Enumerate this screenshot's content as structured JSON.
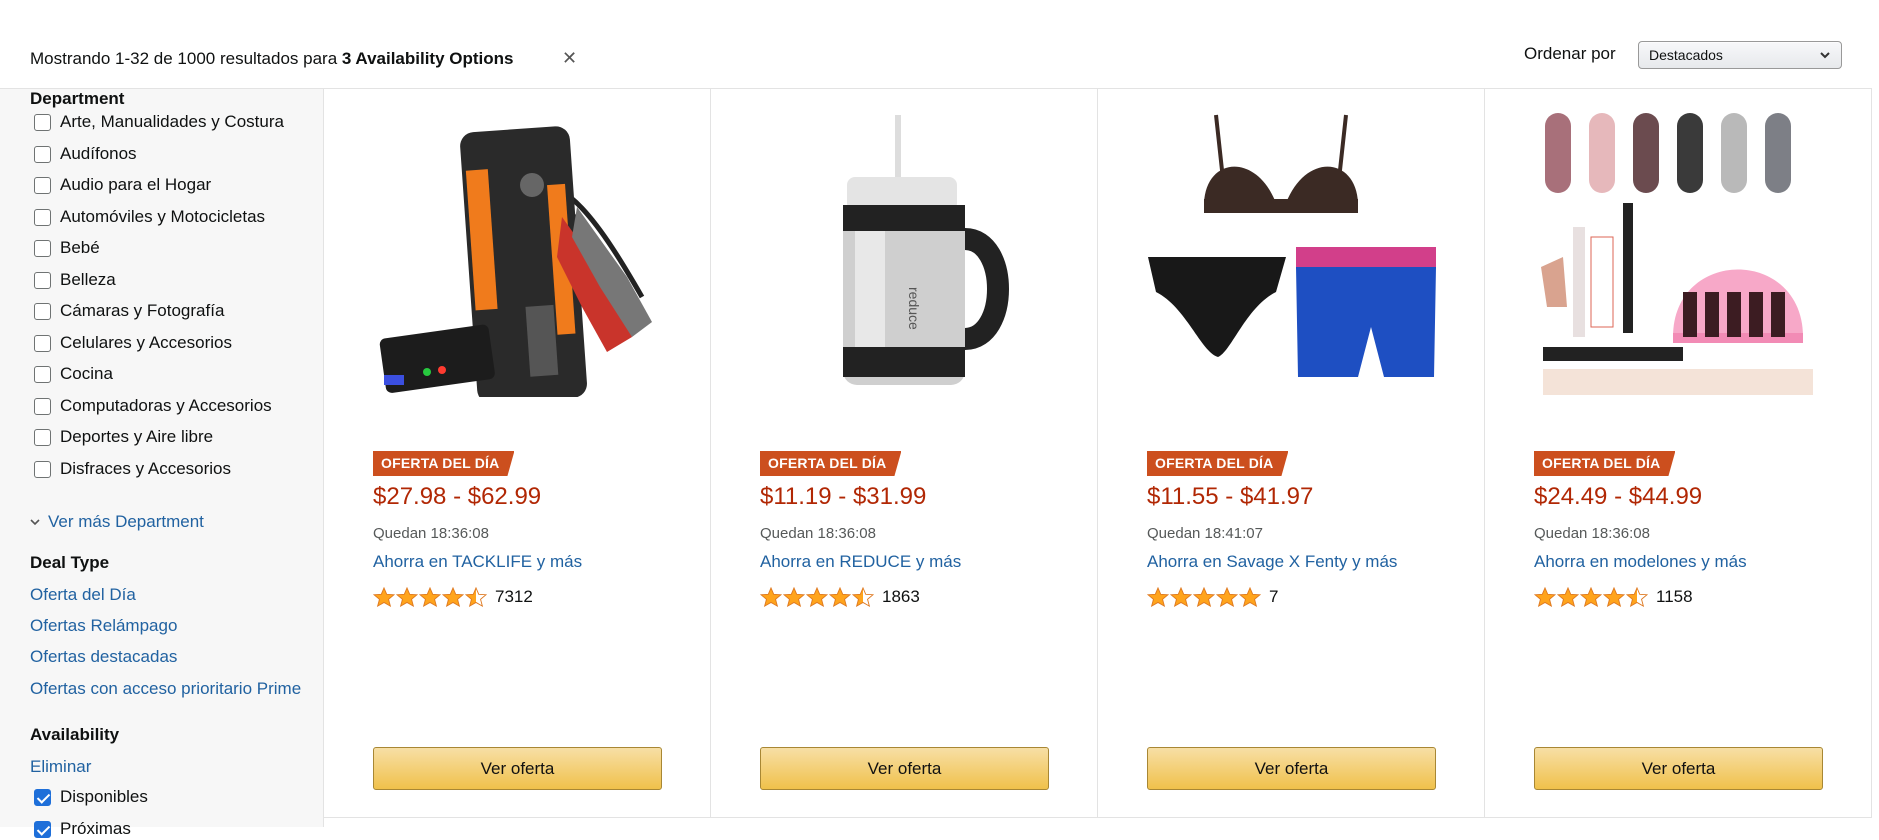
{
  "results": {
    "prefix": "Mostrando 1-32 de 1000 resultados para ",
    "query": "3 Availability Options",
    "clear": "✕"
  },
  "sort": {
    "label": "Ordenar por",
    "selected": "Destacados"
  },
  "sidebar": {
    "department": {
      "title": "Department",
      "items": [
        "Arte, Manualidades y Costura",
        "Audífonos",
        "Audio para el Hogar",
        "Automóviles y Motocicletas",
        "Bebé",
        "Belleza",
        "Cámaras y Fotografía",
        "Celulares y Accesorios",
        "Cocina",
        "Computadoras y Accesorios",
        "Deportes y Aire libre",
        "Disfraces y Accesorios"
      ],
      "see_more": "Ver más Department"
    },
    "deal_type": {
      "title": "Deal Type",
      "links": [
        "Oferta del Día",
        "Ofertas Relámpago",
        "Ofertas destacadas",
        "Ofertas con acceso prioritario Prime"
      ]
    },
    "availability": {
      "title": "Availability",
      "clear": "Eliminar",
      "items": [
        {
          "label": "Disponibles",
          "checked": true
        },
        {
          "label": "Próximas",
          "checked": true
        }
      ]
    }
  },
  "products": [
    {
      "badge": "OFERTA DEL DÍA",
      "price": "$27.98 - $62.99",
      "timer": "Quedan 18:36:08",
      "save": "Ahorra en TACKLIFE y más",
      "rating_stars": 4.5,
      "rating_count": "7312",
      "button": "Ver oferta",
      "image": "jump-starter-image"
    },
    {
      "badge": "OFERTA DEL DÍA",
      "price": "$11.19 - $31.99",
      "timer": "Quedan 18:36:08",
      "save": "Ahorra en REDUCE y más",
      "rating_stars": 4.5,
      "rating_count": "1863",
      "button": "Ver oferta",
      "image": "tumbler-mug-image"
    },
    {
      "badge": "OFERTA DEL DÍA",
      "price": "$11.55 - $41.97",
      "timer": "Quedan 18:41:07",
      "save": "Ahorra en Savage X Fenty y más",
      "rating_stars": 5,
      "rating_count": "7",
      "button": "Ver oferta",
      "image": "lingerie-set-image"
    },
    {
      "badge": "OFERTA DEL DÍA",
      "price": "$24.49 - $44.99",
      "timer": "Quedan 18:36:08",
      "save": "Ahorra en modelones y más",
      "rating_stars": 4.5,
      "rating_count": "1158",
      "button": "Ver oferta",
      "image": "nail-kit-image"
    }
  ],
  "colors": {
    "price": "#b12704",
    "link": "#2162a1",
    "badge": "#cc4f1e",
    "button": "#f0c14b",
    "star": "#ffa41c"
  }
}
